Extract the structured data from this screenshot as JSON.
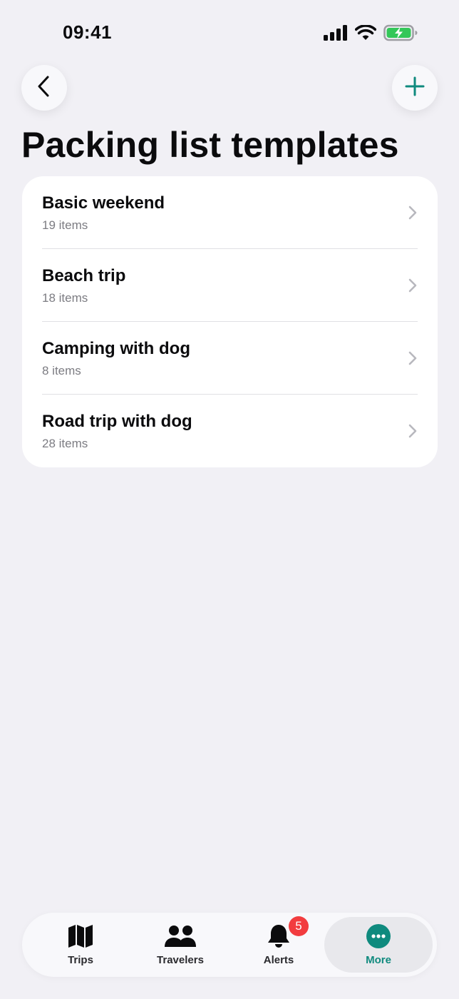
{
  "status_bar": {
    "time": "09:41"
  },
  "header": {
    "back_icon": "chevron-left-icon",
    "add_icon": "plus-icon",
    "title": "Packing list templates"
  },
  "templates": [
    {
      "title": "Basic weekend",
      "subtitle": "19 items"
    },
    {
      "title": "Beach trip",
      "subtitle": "18 items"
    },
    {
      "title": "Camping with dog",
      "subtitle": "8 items"
    },
    {
      "title": "Road trip with dog",
      "subtitle": "28 items"
    }
  ],
  "tab_bar": {
    "trips": {
      "label": "Trips",
      "icon": "map-icon"
    },
    "travelers": {
      "label": "Travelers",
      "icon": "people-icon"
    },
    "alerts": {
      "label": "Alerts",
      "icon": "bell-icon",
      "badge": "5"
    },
    "more": {
      "label": "More",
      "icon": "more-icon",
      "selected": true
    }
  },
  "colors": {
    "background": "#F1F0F5",
    "accent": "#0F8A7E",
    "badge": "#F23C3F",
    "battery": "#34C759"
  }
}
